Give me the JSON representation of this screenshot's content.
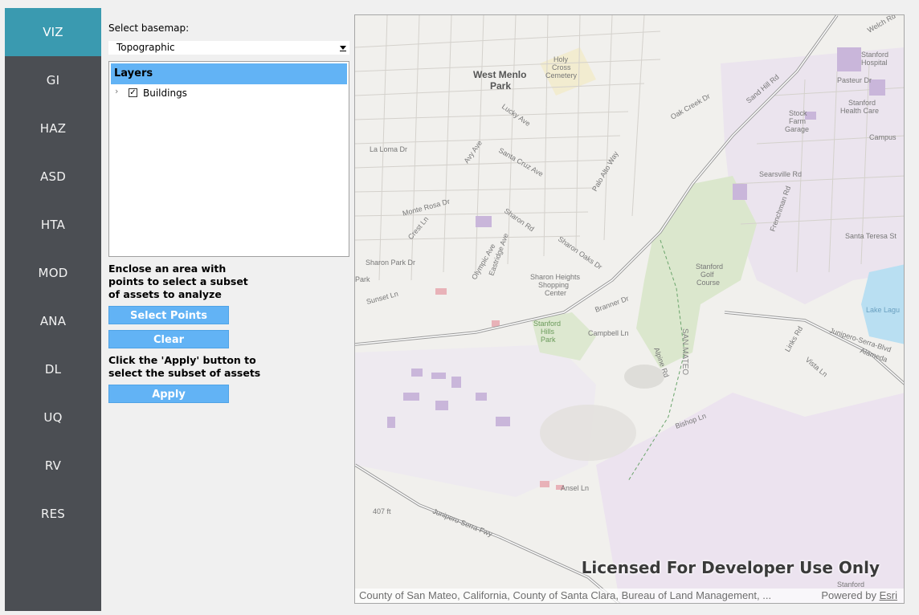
{
  "nav": {
    "items": [
      "VIZ",
      "GI",
      "HAZ",
      "ASD",
      "HTA",
      "MOD",
      "ANA",
      "DL",
      "UQ",
      "RV",
      "RES"
    ],
    "active": "VIZ"
  },
  "basemap": {
    "label": "Select basemap:",
    "selected": "Topographic"
  },
  "layers": {
    "header": "Layers",
    "items": [
      {
        "label": "Buildings",
        "checked": true
      }
    ]
  },
  "selection": {
    "instruction": "Enclose an area with points to select a subset of assets to analyze",
    "select_points_label": "Select Points",
    "clear_label": "Clear",
    "apply_instruction": "Click the 'Apply' button to select the subset of assets",
    "apply_label": "Apply"
  },
  "map": {
    "watermark": "Licensed For Developer Use Only",
    "attribution": "County of San Mateo, California, County of Santa Clara, Bureau of Land Management, ...",
    "powered_prefix": "Powered by",
    "powered_link": "Esri",
    "places": [
      "West Menlo Park",
      "Holy Cross Cemetery",
      "Stanford Hospital",
      "Stanford Health Care",
      "Stock Farm Garage",
      "Stanford Golf Course",
      "Sharon Heights Shopping Center",
      "Stanford Hills Park",
      "SAN MATEO",
      "Lake Lagu",
      "Junipero-Serra-Blvd",
      "Junipero-Serra-Fwy",
      "Sand Hill Rd",
      "Alameda",
      "Sharon Park Dr",
      "Santa Cruz Ave",
      "Searsville Rd",
      "Santa Teresa St",
      "Campus",
      "Pasteur Dr",
      "Welch Rd",
      "Campbell Ln",
      "Branner Dr",
      "Alpine Rd",
      "Bishop Ln",
      "Ansel Ln",
      "407 ft",
      "Stanford",
      "Links Rd",
      "Vista Ln",
      "Frenchman Rd",
      "Olympic Ave",
      "Eastridge Ave",
      "Crest Ln",
      "Monte Rosa Dr",
      "La Loma Dr",
      "Avy Ave",
      "Lucky Ave",
      "Sharon Rd",
      "Sharon Oaks Dr",
      "Oak Creek Dr",
      "Palo Alto Way",
      "Park",
      "Sunset Ln",
      "Sand Hill Rd"
    ]
  }
}
